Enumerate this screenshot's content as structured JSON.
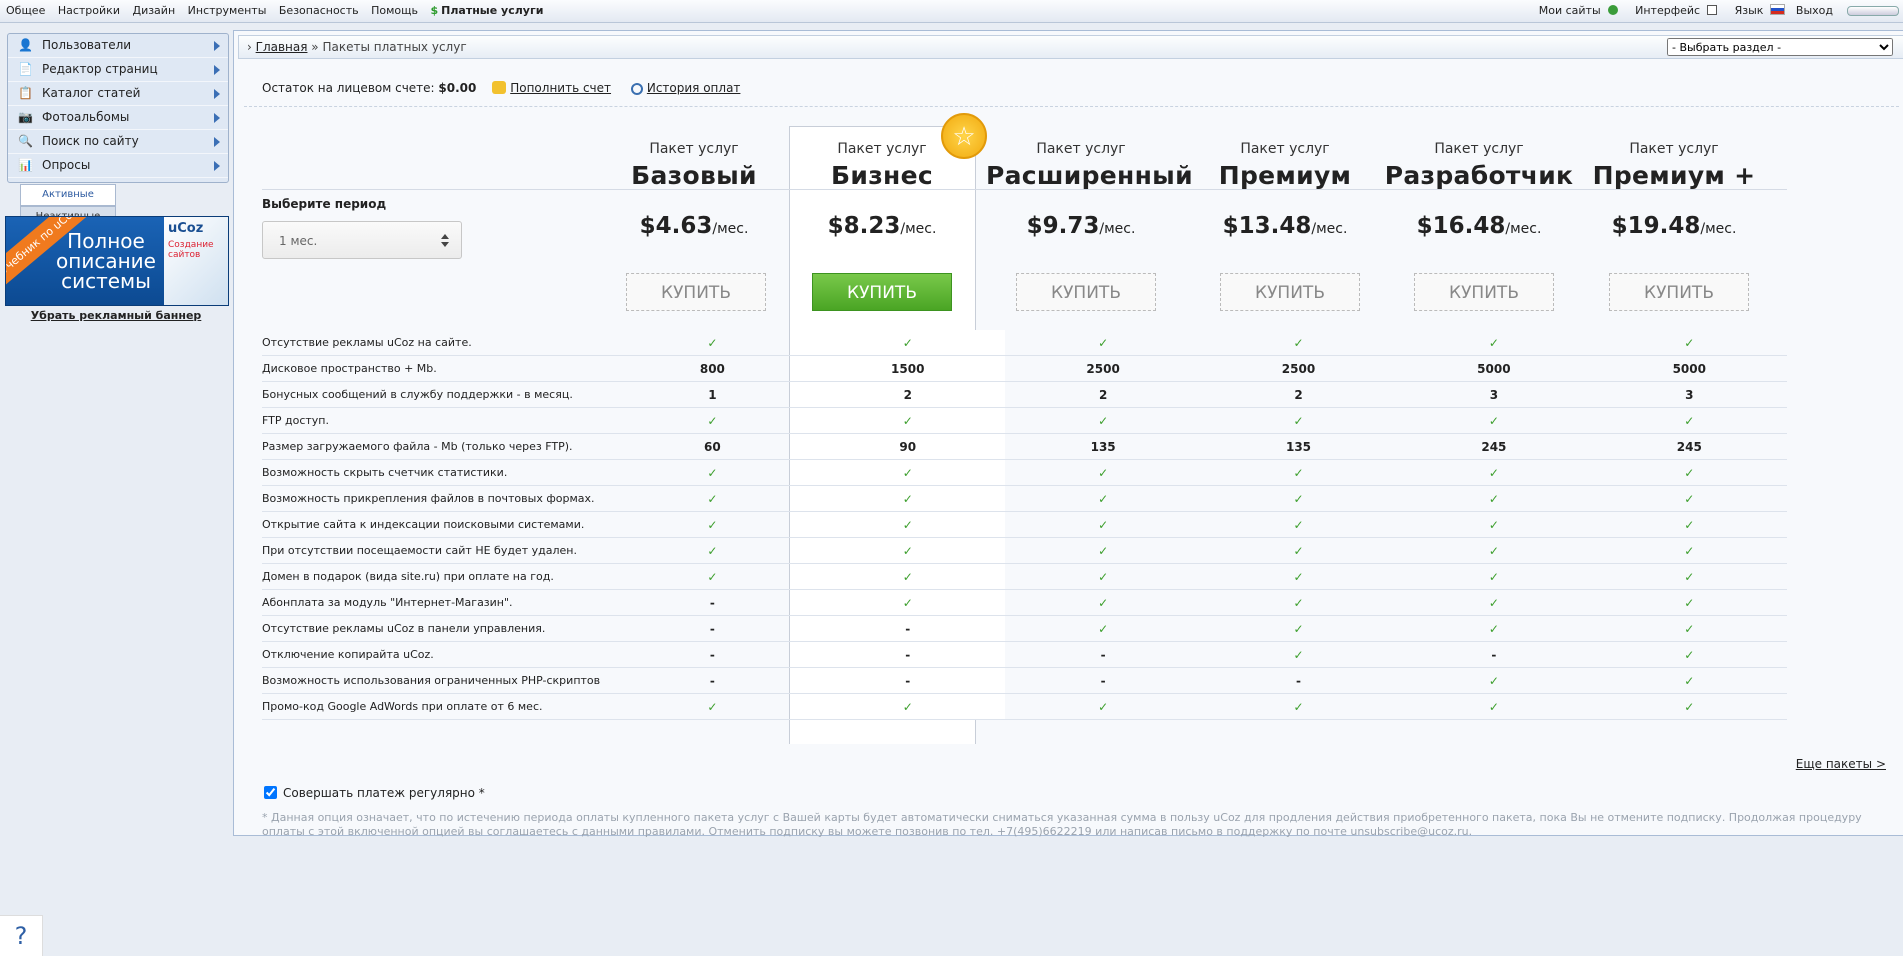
{
  "topbar": {
    "menu": [
      "Общее",
      "Настройки",
      "Дизайн",
      "Инструменты",
      "Безопасность",
      "Помощь"
    ],
    "paid": "Платные услуги",
    "right": {
      "my_sites": "Мои сайты",
      "interface": "Интерфейс",
      "language": "Язык",
      "logout": "Выход"
    }
  },
  "sidebar": {
    "items": [
      {
        "label": "Пользователи",
        "icon": "user-icon"
      },
      {
        "label": "Редактор страниц",
        "icon": "page-icon"
      },
      {
        "label": "Каталог статей",
        "icon": "catalog-icon"
      },
      {
        "label": "Фотоальбомы",
        "icon": "camera-icon"
      },
      {
        "label": "Поиск по сайту",
        "icon": "search-icon"
      },
      {
        "label": "Опросы",
        "icon": "chart-icon"
      }
    ],
    "tab_active": "Активные",
    "tab_inactive": "Неактивные"
  },
  "banner": {
    "ribbon": "Учебник по uCoz",
    "text": "Полное описание системы",
    "logo": "uCoz",
    "box_caption": "Создание сайтов",
    "remove_link": "Убрать рекламный баннер"
  },
  "breadcrumb": {
    "home": "Главная",
    "sep": "»",
    "current": "Пакеты платных услуг",
    "section_select": "- Выбрать раздел -"
  },
  "account": {
    "label": "Остаток на лицевом счете:",
    "balance": "$0.00",
    "topup": "Пополнить счет",
    "history": "История оплат"
  },
  "period": {
    "label": "Выберите период",
    "value": "1 мес."
  },
  "plans": [
    {
      "sub": "Пакет услуг",
      "name": "Базовый",
      "price": "$4.63",
      "per": "/мес.",
      "buy": "КУПИТЬ"
    },
    {
      "sub": "Пакет услуг",
      "name": "Бизнес",
      "price": "$8.23",
      "per": "/мес.",
      "buy": "КУПИТЬ"
    },
    {
      "sub": "Пакет услуг",
      "name": "Расширенный",
      "price": "$9.73",
      "per": "/мес.",
      "buy": "КУПИТЬ"
    },
    {
      "sub": "Пакет услуг",
      "name": "Премиум",
      "price": "$13.48",
      "per": "/мес.",
      "buy": "КУПИТЬ"
    },
    {
      "sub": "Пакет услуг",
      "name": "Разработчик",
      "price": "$16.48",
      "per": "/мес.",
      "buy": "КУПИТЬ"
    },
    {
      "sub": "Пакет услуг",
      "name": "Премиум +",
      "price": "$19.48",
      "per": "/мес.",
      "buy": "КУПИТЬ"
    }
  ],
  "features": [
    {
      "label": "Отсутствие рекламы uCoz на сайте.",
      "values": [
        "✓",
        "✓",
        "✓",
        "✓",
        "✓",
        "✓"
      ]
    },
    {
      "label": "Дисковое пространство + Mb.",
      "values": [
        "800",
        "1500",
        "2500",
        "2500",
        "5000",
        "5000"
      ]
    },
    {
      "label": "Бонусных сообщений в службу поддержки - в месяц.",
      "values": [
        "1",
        "2",
        "2",
        "2",
        "3",
        "3"
      ]
    },
    {
      "label": "FTP доступ.",
      "values": [
        "✓",
        "✓",
        "✓",
        "✓",
        "✓",
        "✓"
      ]
    },
    {
      "label": "Размер загружаемого файла - Mb (только через FTP).",
      "values": [
        "60",
        "90",
        "135",
        "135",
        "245",
        "245"
      ]
    },
    {
      "label": "Возможность скрыть счетчик статистики.",
      "values": [
        "✓",
        "✓",
        "✓",
        "✓",
        "✓",
        "✓"
      ]
    },
    {
      "label": "Возможность прикрепления файлов в почтовых формах.",
      "values": [
        "✓",
        "✓",
        "✓",
        "✓",
        "✓",
        "✓"
      ]
    },
    {
      "label": "Открытие сайта к индексации поисковыми системами.",
      "values": [
        "✓",
        "✓",
        "✓",
        "✓",
        "✓",
        "✓"
      ]
    },
    {
      "label": "При отсутствии посещаемости сайт НЕ будет удален.",
      "values": [
        "✓",
        "✓",
        "✓",
        "✓",
        "✓",
        "✓"
      ]
    },
    {
      "label": "Домен в подарок (вида site.ru) при оплате на год.",
      "values": [
        "✓",
        "✓",
        "✓",
        "✓",
        "✓",
        "✓"
      ]
    },
    {
      "label": "Абонплата за модуль \"Интернет-Магазин\".",
      "values": [
        "-",
        "✓",
        "✓",
        "✓",
        "✓",
        "✓"
      ]
    },
    {
      "label": "Отсутствие рекламы uCoz в панели управления.",
      "values": [
        "-",
        "-",
        "✓",
        "✓",
        "✓",
        "✓"
      ]
    },
    {
      "label": "Отключение копирайта uCoz.",
      "values": [
        "-",
        "-",
        "-",
        "✓",
        "-",
        "✓"
      ]
    },
    {
      "label": "Возможность использования ограниченных PHP-скриптов",
      "values": [
        "-",
        "-",
        "-",
        "-",
        "✓",
        "✓"
      ]
    },
    {
      "label": "Промо-код Google AdWords при оплате от 6 мес.",
      "values": [
        "✓",
        "✓",
        "✓",
        "✓",
        "✓",
        "✓"
      ]
    }
  ],
  "more_packages": "Еще пакеты >",
  "recurring": "Совершать платеж регулярно *",
  "note": "* Данная опция означает, что по истечению периода оплаты купленного пакета услуг с Вашей карты будет автоматически сниматься указанная сумма в пользу uCoz для продления действия приобретенного пакета, пока Вы не отмените подписку. Продолжая процедуру оплаты с этой включенной опцией вы соглашаетесь с данными правилами. Отменить подписку вы можете позвонив по тел. +7(495)6622219 или написав письмо в поддержку по почте unsubscribe@ucoz.ru.",
  "help": "?"
}
